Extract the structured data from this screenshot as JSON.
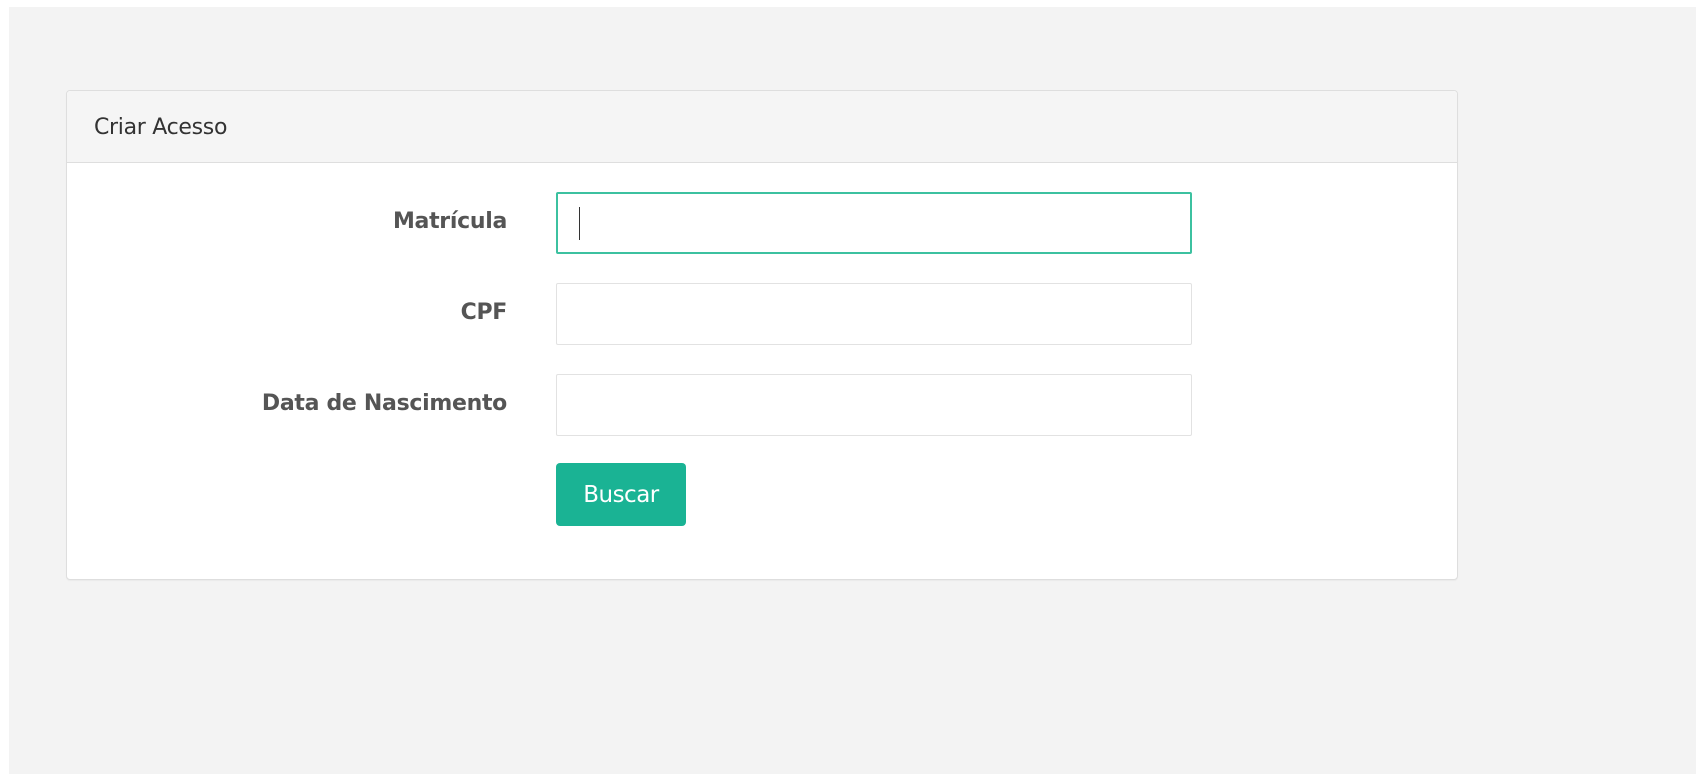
{
  "panel": {
    "title": "Criar Acesso"
  },
  "form": {
    "fields": [
      {
        "label": "Matrícula",
        "value": "",
        "placeholder": "",
        "focused": true
      },
      {
        "label": "CPF",
        "value": "",
        "placeholder": ""
      },
      {
        "label": "Data de Nascimento",
        "value": "",
        "placeholder": ""
      }
    ],
    "submit_label": "Buscar"
  },
  "colors": {
    "primary": "#1ab394",
    "focus_border": "#3cc1a0",
    "page_background": "#f3f3f3"
  }
}
